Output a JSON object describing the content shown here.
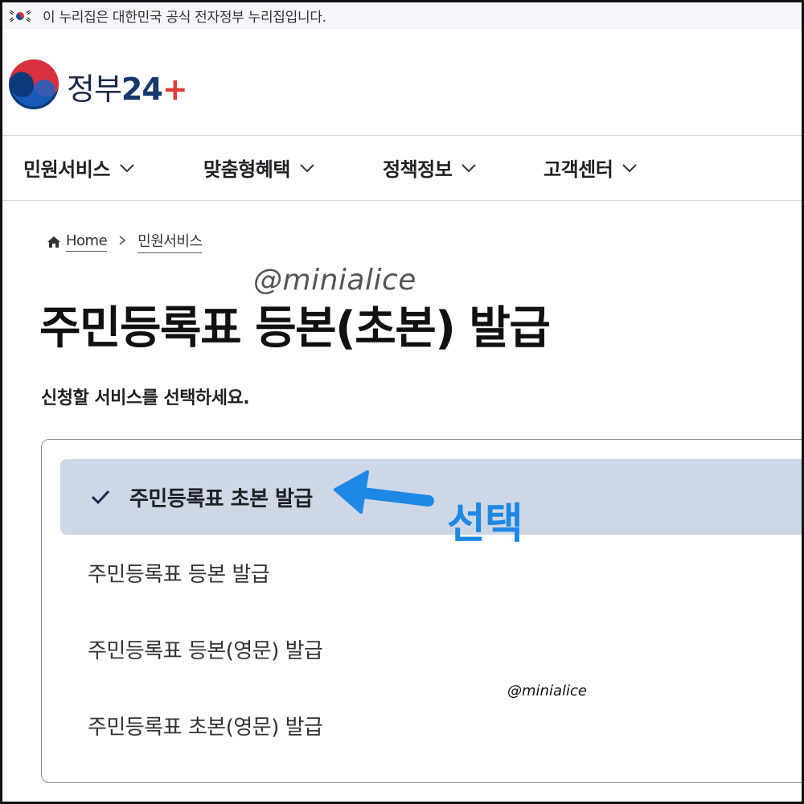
{
  "gov_banner": {
    "text": "이 누리집은 대한민국 공식 전자정부 누리집입니다."
  },
  "logo": {
    "text_main": "정부",
    "text_num": "24",
    "text_plus": "+"
  },
  "nav": {
    "items": [
      {
        "label": "민원서비스"
      },
      {
        "label": "맞춤형혜택"
      },
      {
        "label": "정책정보"
      },
      {
        "label": "고객센터"
      }
    ]
  },
  "breadcrumb": {
    "home": "Home",
    "current": "민원서비스"
  },
  "page": {
    "title": "주민등록표 등본(초본) 발급",
    "subtitle": "신청할 서비스를 선택하세요."
  },
  "options": [
    {
      "label": "주민등록표 초본 발급",
      "selected": true
    },
    {
      "label": "주민등록표 등본 발급",
      "selected": false
    },
    {
      "label": "주민등록표 등본(영문) 발급",
      "selected": false
    },
    {
      "label": "주민등록표 초본(영문) 발급",
      "selected": false
    }
  ],
  "annotation": {
    "text": "선택",
    "color": "#1e88e5"
  },
  "watermarks": {
    "large": "@minialice",
    "small": "@minialice"
  },
  "colors": {
    "selected_bg": "#cdd7e5",
    "logo_blue": "#17386d",
    "logo_red": "#e03a3a"
  }
}
